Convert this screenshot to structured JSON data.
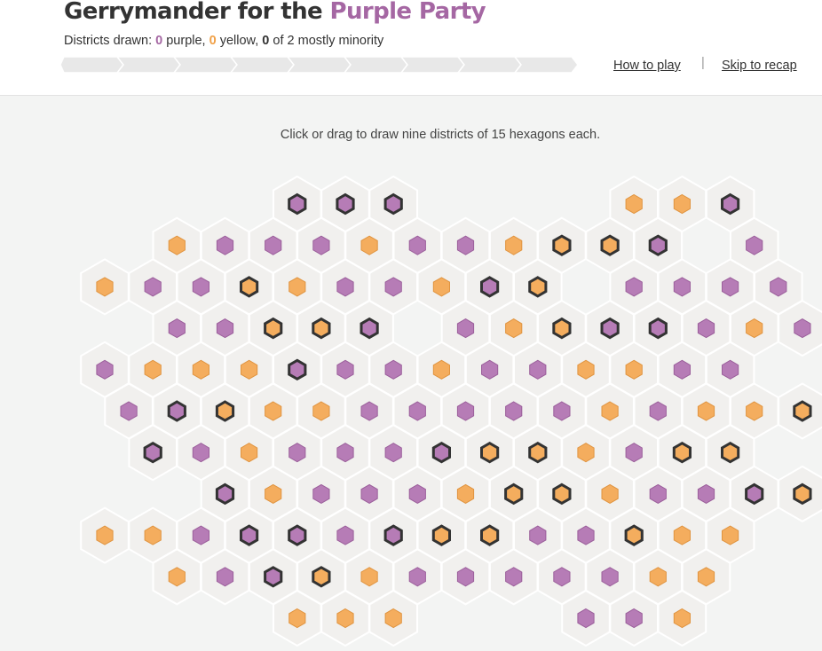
{
  "header": {
    "title_prefix": "Gerrymander for the ",
    "title_party": "Purple Party",
    "subtitle": {
      "prefix": "Districts drawn: ",
      "purple_count": "0",
      "purple_label": " purple, ",
      "yellow_count": "0",
      "yellow_label": " yellow, ",
      "minority_count": "0",
      "minority_label": " of 2 mostly minority"
    },
    "progress": {
      "total_districts": 9,
      "drawn": 0
    },
    "links": {
      "how_to_play": "How to play",
      "separator": "|",
      "skip": "Skip to recap"
    }
  },
  "board": {
    "instructions": "Click or drag to draw nine districts of 15 hexagons each.",
    "legend": {
      "P": "purple voter",
      "Y": "yellow voter",
      "p": "purple voter (minority)",
      "y": "yellow voter (minority)"
    },
    "rows": [
      "    ppp    YYp  ",
      " YPPPYPPYyyp P  ",
      "YPPyYPPYpy PPPP ",
      " PPyyp PYyppPYPP",
      "PYYYpPPYPPYYPP  ",
      "PpyYYPPPPPYPYYy ",
      " pPYPPPpyyYPyy  ",
      "  pYPPPYyyYPPpyy",
      "YYPppPpyyPPyYY  ",
      " YPpyYPPPPPYY   ",
      "    YYY   PPY   "
    ],
    "colors": {
      "purple": "#b67cb6",
      "purple_stroke": "#9b5f9b",
      "yellow": "#f4ad5e",
      "yellow_stroke": "#e09440",
      "minority_ring": "#333333",
      "cell": "#f1f0ee",
      "cell_stroke": "#ffffff"
    }
  }
}
